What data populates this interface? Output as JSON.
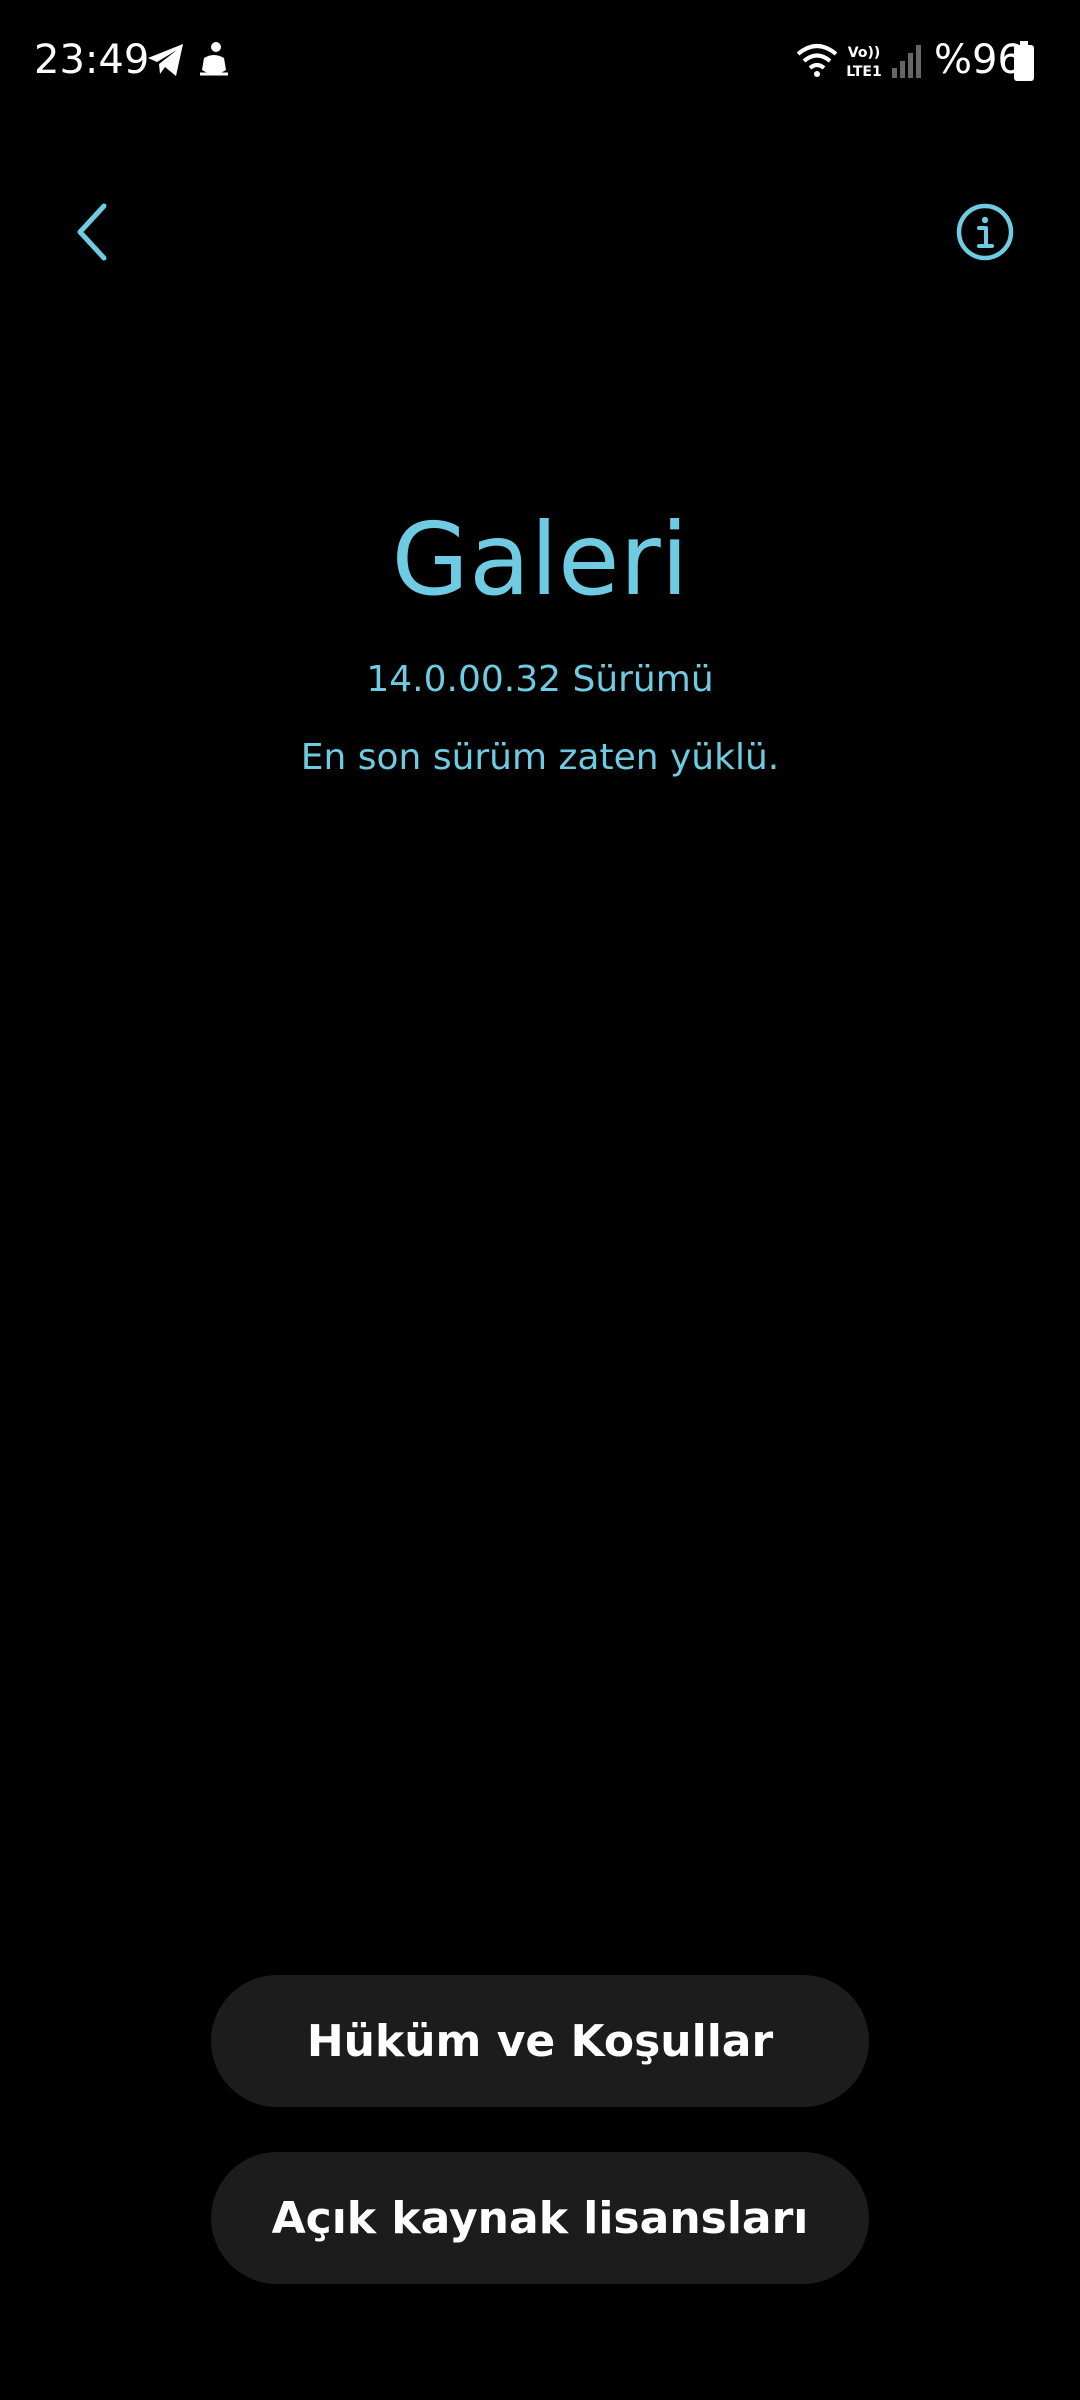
{
  "status_bar": {
    "time": "23:49",
    "battery": "%96",
    "icons": [
      "telegram-icon",
      "app-notification-icon",
      "wifi-icon",
      "volte-lte1-icon",
      "signal-icon",
      "battery-icon"
    ],
    "volte_label_top": "Vo))",
    "volte_label_bottom": "LTE1"
  },
  "header": {
    "back_icon": "chevron-left-icon",
    "info_icon": "info-icon"
  },
  "app_info": {
    "title": "Galeri",
    "version": "14.0.00.32 Sürümü",
    "status": "En son sürüm zaten yüklü."
  },
  "actions": {
    "terms_label": "Hüküm ve Koşullar",
    "licenses_label": "Açık kaynak lisansları"
  },
  "colors": {
    "accent": "#6ecbe2",
    "background": "#000000",
    "button_bg": "#1c1c1c",
    "text": "#ffffff"
  }
}
